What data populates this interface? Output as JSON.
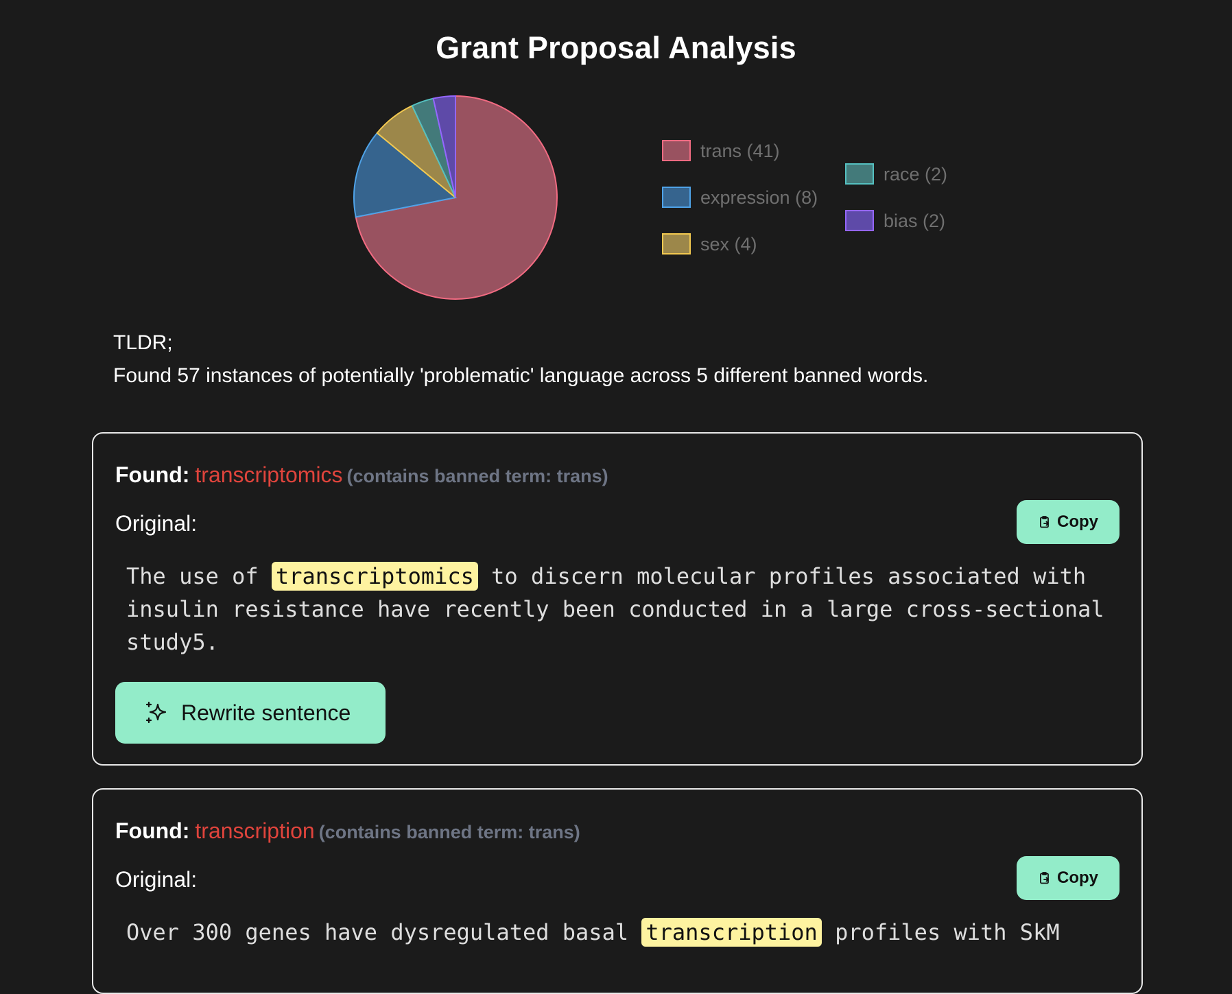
{
  "title": "Grant Proposal Analysis",
  "chart_data": {
    "type": "pie",
    "slices": [
      {
        "label": "trans (41)",
        "value": 41,
        "fill": "#995260",
        "stroke": "#f26b82"
      },
      {
        "label": "expression (8)",
        "value": 8,
        "fill": "#36648e",
        "stroke": "#4fa3e8"
      },
      {
        "label": "sex (4)",
        "value": 4,
        "fill": "#9c874a",
        "stroke": "#f3c950"
      },
      {
        "label": "race (2)",
        "value": 2,
        "fill": "#437a7a",
        "stroke": "#55c0c0"
      },
      {
        "label": "bias (2)",
        "value": 2,
        "fill": "#5e4aa8",
        "stroke": "#9566ff"
      }
    ],
    "legend": [
      "trans (41)",
      "expression (8)",
      "sex (4)",
      "race (2)",
      "bias (2)"
    ],
    "legend_placement": "right"
  },
  "tldr": {
    "heading": "TLDR;",
    "summary": "Found 57 instances of potentially 'problematic' language across 5 different banned words."
  },
  "results": [
    {
      "found_label": "Found:",
      "word": "transcriptomics",
      "note": "(contains banned term: trans)",
      "original_label": "Original:",
      "copy_label": "Copy",
      "sentence_before": "The use of ",
      "sentence_highlight": "transcriptomics",
      "sentence_after": " to discern molecular profiles associated with insulin resistance have recently been conducted in a large cross-sectional study5.",
      "rewrite_label": "Rewrite sentence"
    },
    {
      "found_label": "Found:",
      "word": "transcription",
      "note": "(contains banned term: trans)",
      "original_label": "Original:",
      "copy_label": "Copy",
      "sentence_before": "Over 300 genes have dysregulated basal ",
      "sentence_highlight": "transcription",
      "sentence_after": " profiles with SkM"
    }
  ]
}
